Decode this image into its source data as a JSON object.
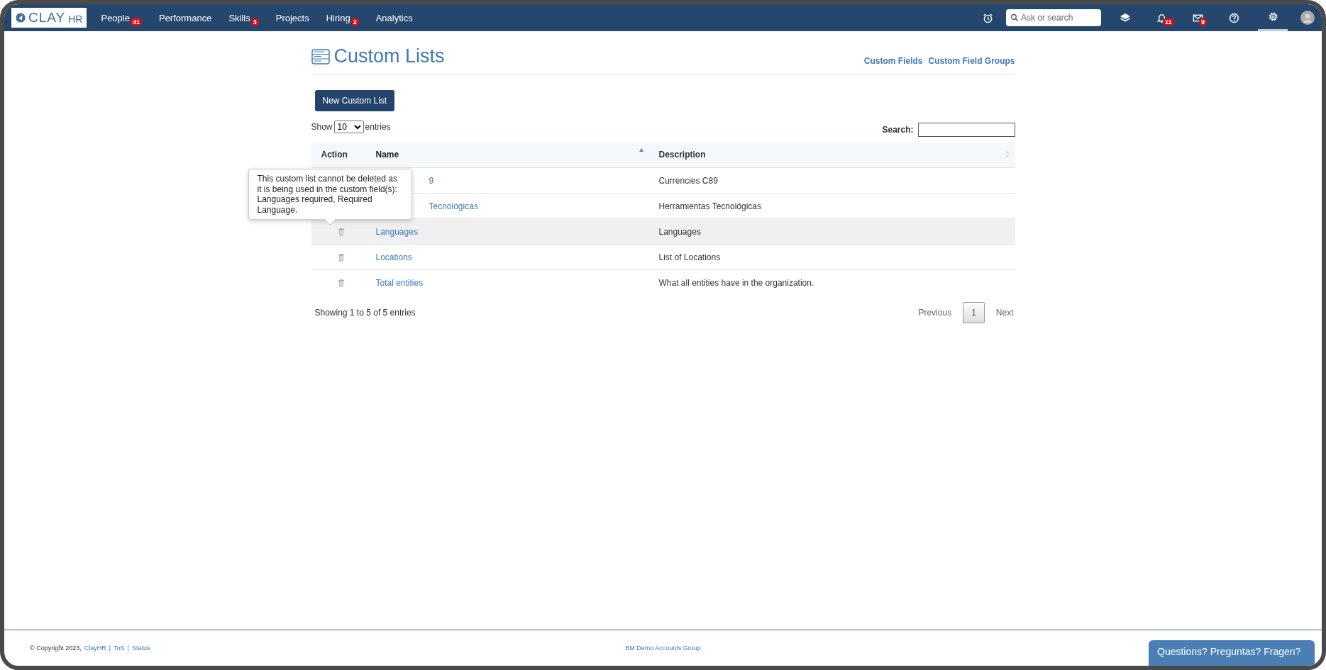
{
  "nav": {
    "logo": {
      "main": "CLAY",
      "suffix": "HR"
    },
    "items": [
      {
        "label": "People",
        "badge": "41"
      },
      {
        "label": "Performance"
      },
      {
        "label": "Skills",
        "badge": "3"
      },
      {
        "label": "Projects"
      },
      {
        "label": "Hiring",
        "badge": "2"
      },
      {
        "label": "Analytics"
      }
    ],
    "search": {
      "placeholder": "Ask or search"
    },
    "notifications": {
      "badge": "11"
    },
    "messages": {
      "badge": "9"
    },
    "settings": {
      "selected": true
    }
  },
  "page": {
    "title": "Custom Lists",
    "links": [
      "Custom Fields",
      "Custom Field Groups"
    ],
    "new_button": "New Custom List",
    "length_menu": {
      "prefix": "Show",
      "value": "10",
      "suffix": "entries"
    },
    "search": {
      "label": "Search:"
    },
    "table": {
      "columns": [
        {
          "label": "Action",
          "sortable": false,
          "sorted_ascending": false
        },
        {
          "label": "Name",
          "sortable": true,
          "sorted_ascending": true
        },
        {
          "label": "Description",
          "sortable": true,
          "sorted_ascending": false
        }
      ],
      "rows": [
        {
          "name": "9",
          "description": "Currencies C89",
          "covered": true,
          "highlighted": false
        },
        {
          "name": "Tecnológicas",
          "description": "Herramientas Tecnológicas",
          "covered": true,
          "highlighted": false
        },
        {
          "name": "Languages",
          "description": "Languages",
          "covered": false,
          "highlighted": true
        },
        {
          "name": "Locations",
          "description": "List of Locations",
          "covered": false,
          "highlighted": false
        },
        {
          "name": "Total entities",
          "description": "What all entities have in the organization.",
          "covered": false,
          "highlighted": false
        }
      ]
    },
    "tooltip": "This custom list cannot be deleted as it is being used in the custom field(s): Languages required, Required Language.",
    "info": "Showing 1 to 5 of 5 entries",
    "pagination": {
      "previous": "Previous",
      "pages": [
        {
          "label": "1",
          "selected": true
        }
      ],
      "next": "Next"
    }
  },
  "footer": {
    "copyright": "© Copyright 2023,",
    "links": [
      "ClayHR",
      "ToS",
      "Status"
    ],
    "separators": [
      "|",
      "|"
    ],
    "center": "BM Demo Accounts Group",
    "chat": "Questions? Preguntas? Fragen?"
  }
}
